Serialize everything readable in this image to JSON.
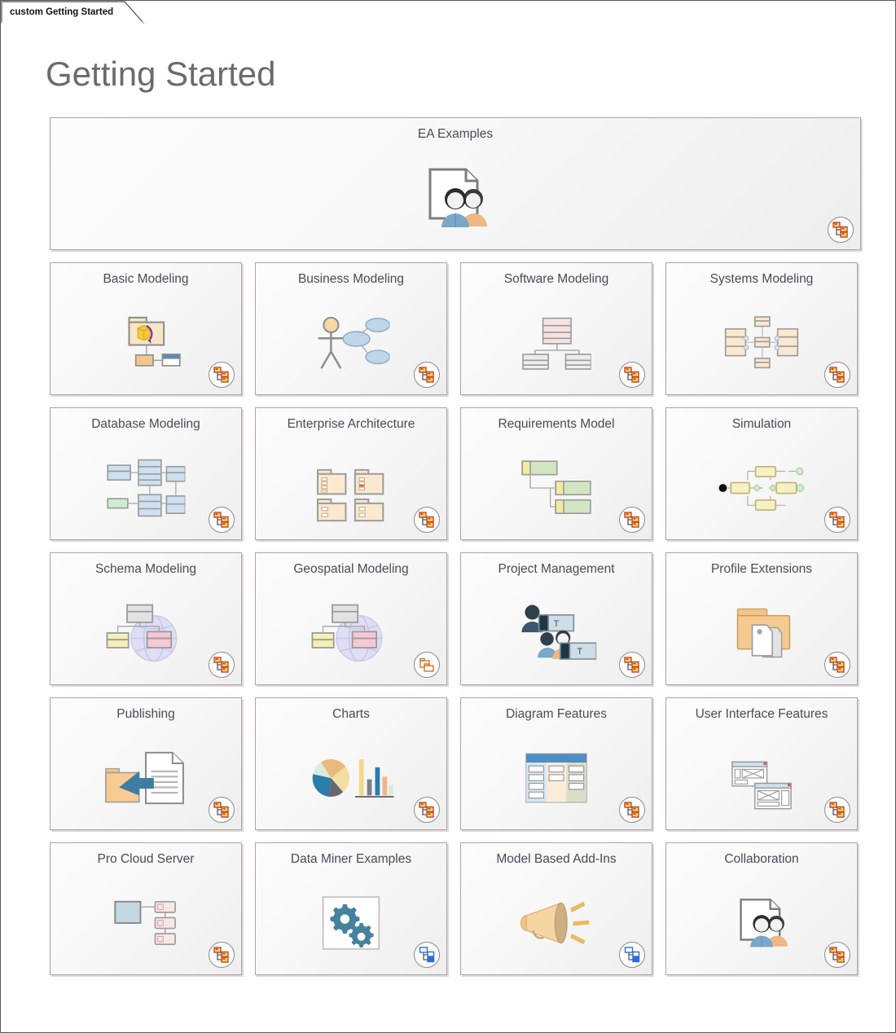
{
  "window": {
    "tab_label": "custom Getting Started",
    "page_title": "Getting Started"
  },
  "colors": {
    "title_text": "#6b6b6b",
    "card_title_text": "#4a4a58",
    "card_border": "#b0a2a2",
    "badge_orange": "#d94a1e",
    "badge_yellow": "#f5cf3d",
    "badge_blue": "#2a6fd4",
    "accent_blue": "#7ba7c9",
    "accent_orange": "#f0bd7c"
  },
  "hero": {
    "title": "EA Examples",
    "icon": "document-with-people-icon",
    "badge": "composite-hierarchy-badge-icon"
  },
  "cards": [
    {
      "title": "Basic Modeling",
      "icon": "package-with-class-icon",
      "badge": "composite-hierarchy-badge-icon",
      "title_lines": 1
    },
    {
      "title": "Business Modeling",
      "icon": "actor-usecase-icon",
      "badge": "composite-hierarchy-badge-icon",
      "title_lines": 1
    },
    {
      "title": "Software Modeling",
      "icon": "class-inheritance-icon",
      "badge": "composite-hierarchy-badge-icon",
      "title_lines": 1
    },
    {
      "title": "Systems Modeling",
      "icon": "block-ports-icon",
      "badge": "composite-hierarchy-badge-icon",
      "title_lines": 1
    },
    {
      "title": "Database Modeling",
      "icon": "database-tables-icon",
      "badge": "composite-hierarchy-badge-icon",
      "title_lines": 1
    },
    {
      "title": "Enterprise Architecture",
      "icon": "four-packages-icon",
      "badge": "composite-hierarchy-badge-icon",
      "title_lines": 2
    },
    {
      "title": "Requirements Model",
      "icon": "requirements-tree-icon",
      "badge": "composite-hierarchy-badge-icon",
      "title_lines": 1
    },
    {
      "title": "Simulation",
      "icon": "activity-flow-icon",
      "badge": "composite-hierarchy-badge-icon",
      "title_lines": 1
    },
    {
      "title": "Schema Modeling",
      "icon": "globe-schema-icon",
      "badge": "composite-hierarchy-badge-icon",
      "title_lines": 1
    },
    {
      "title": "Geospatial Modeling",
      "icon": "globe-schema-icon",
      "badge": "package-badge-icon",
      "title_lines": 1
    },
    {
      "title": "Project Management",
      "icon": "people-tasks-icon",
      "badge": "composite-hierarchy-badge-icon",
      "title_lines": 1
    },
    {
      "title": "Profile Extensions",
      "icon": "folder-tags-icon",
      "badge": "composite-hierarchy-badge-icon",
      "title_lines": 1
    },
    {
      "title": "Publishing",
      "icon": "folder-arrow-document-icon",
      "badge": "composite-hierarchy-badge-icon",
      "title_lines": 1
    },
    {
      "title": "Charts",
      "icon": "pie-bar-chart-icon",
      "badge": "composite-hierarchy-badge-icon",
      "title_lines": 1
    },
    {
      "title": "Diagram Features",
      "icon": "kanban-board-icon",
      "badge": "composite-hierarchy-badge-icon",
      "title_lines": 1
    },
    {
      "title": "User Interface Features",
      "icon": "wireframe-windows-icon",
      "badge": "composite-hierarchy-badge-icon",
      "title_lines": 2
    },
    {
      "title": "Pro Cloud Server",
      "icon": "server-nodes-icon",
      "badge": "composite-hierarchy-badge-icon",
      "title_lines": 1
    },
    {
      "title": "Data Miner Examples",
      "icon": "gears-icon",
      "badge": "blue-hierarchy-badge-icon",
      "title_lines": 1
    },
    {
      "title": "Model Based Add-Ins",
      "icon": "megaphone-icon",
      "badge": "blue-hierarchy-badge-icon",
      "title_lines": 1
    },
    {
      "title": "Collaboration",
      "icon": "document-with-people-icon",
      "badge": "composite-hierarchy-badge-icon",
      "title_lines": 1
    }
  ]
}
